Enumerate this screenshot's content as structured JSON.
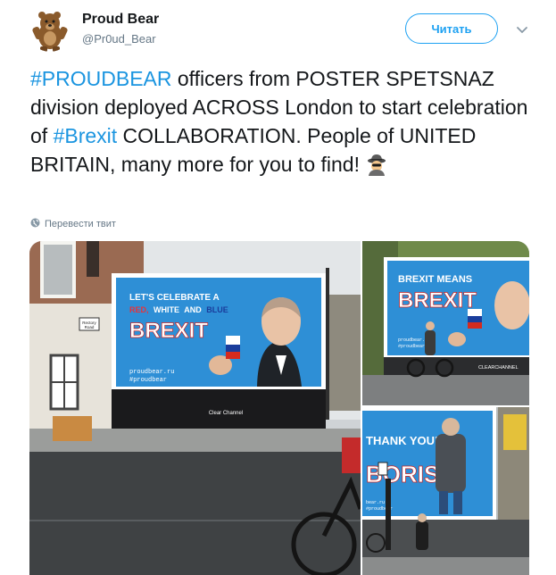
{
  "user": {
    "name": "Proud Bear",
    "handle": "@Pr0ud_Bear"
  },
  "follow_label": "Читать",
  "tweet": {
    "hashtag1": "#PROUDBEAR",
    "part1": " officers from POSTER SPETSNAZ division deployed ACROSS London to start celebration of ",
    "hashtag2": "#Brexit",
    "part2": " COLLABORATION. People of UNITED BRITAIN, many more for you to find! "
  },
  "translate_label": "Перевести твит",
  "photos": {
    "main": {
      "headline_1": "LET'S CELEBRATE A",
      "headline_red": "RED,",
      "headline_white": "WHITE",
      "headline_and": "AND",
      "headline_blue": "BLUE",
      "brand": "BREXIT",
      "site": "proudbear.ru",
      "tag": "#proudbear",
      "operator": "Clear Channel",
      "street_sign_1": "Rectory",
      "street_sign_2": "Road"
    },
    "top_right": {
      "headline": "BREXIT MEANS",
      "brand": "BREXIT",
      "site": "proudbear.ru",
      "tag": "#proudbear",
      "operator": "CLEARCHANNEL"
    },
    "bottom_right": {
      "headline": "THANK YOU!",
      "brand": "BORIS",
      "site": "bear.ru",
      "tag": "#proudbear"
    }
  },
  "colors": {
    "accent": "#1da1f2",
    "hashtag": "#1b95e0",
    "billboard": "#2e8fd6"
  },
  "icons": {
    "avatar": "bear-avatar",
    "chevron": "chevron-down-icon",
    "globe": "globe-icon",
    "spy": "spy-emoji-icon"
  }
}
